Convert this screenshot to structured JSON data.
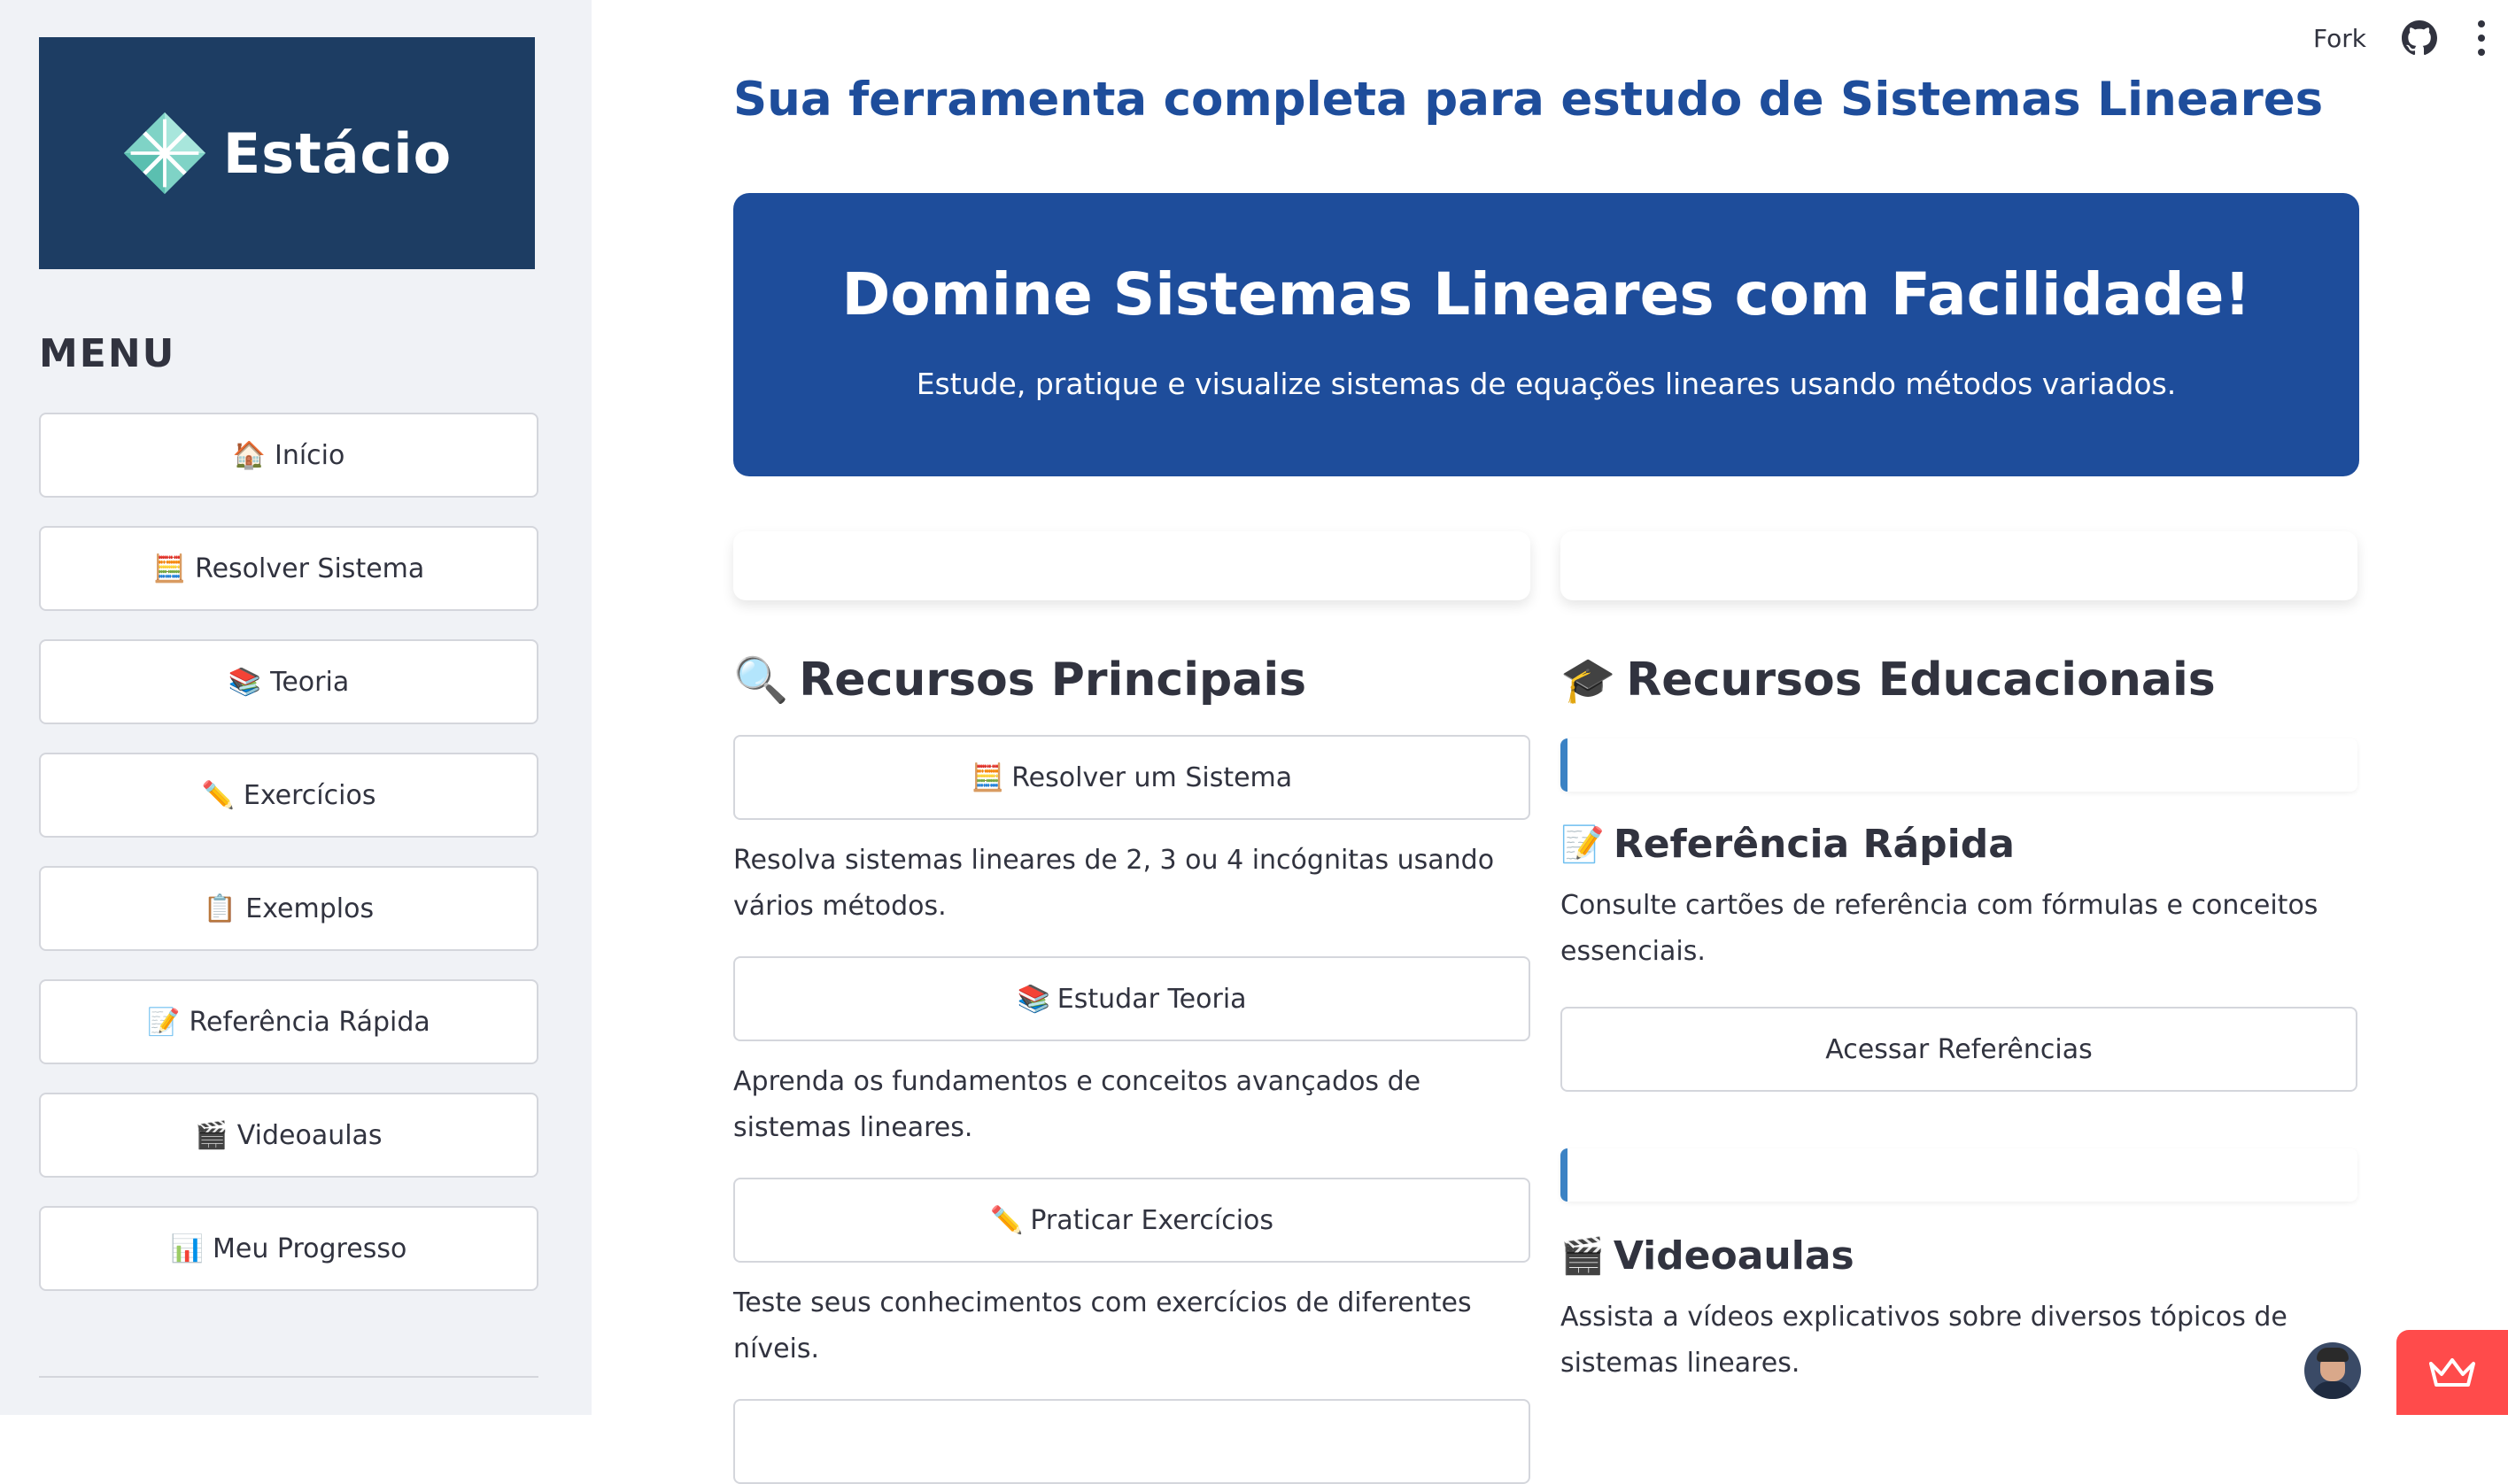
{
  "header": {
    "fork_label": "Fork",
    "github_icon": "github-icon",
    "menu_icon": "kebab-menu-icon"
  },
  "sidebar": {
    "logo_text": "Estácio",
    "menu_title": "MENU",
    "items": [
      {
        "icon": "🏠",
        "label": "Início"
      },
      {
        "icon": "🧮",
        "label": "Resolver Sistema"
      },
      {
        "icon": "📚",
        "label": "Teoria"
      },
      {
        "icon": "✏️",
        "label": "Exercícios"
      },
      {
        "icon": "📋",
        "label": "Exemplos"
      },
      {
        "icon": "📝",
        "label": "Referência Rápida"
      },
      {
        "icon": "🎬",
        "label": "Videoaulas"
      },
      {
        "icon": "📊",
        "label": "Meu Progresso"
      }
    ]
  },
  "main": {
    "title": "Sua ferramenta completa para estudo de Sistemas Lineares",
    "hero": {
      "title": "Domine Sistemas Lineares com Facilidade!",
      "subtitle": "Estude, pratique e visualize sistemas de equações lineares usando métodos variados."
    },
    "left": {
      "heading_icon": "🔍",
      "heading": "Recursos Principais",
      "items": [
        {
          "icon": "🧮",
          "button": "Resolver um Sistema",
          "desc": "Resolva sistemas lineares de 2, 3 ou 4 incógnitas usando vários métodos."
        },
        {
          "icon": "📚",
          "button": "Estudar Teoria",
          "desc": "Aprenda os fundamentos e conceitos avançados de sistemas lineares."
        },
        {
          "icon": "✏️",
          "button": "Praticar Exercícios",
          "desc": "Teste seus conhecimentos com exercícios de diferentes níveis."
        }
      ]
    },
    "right": {
      "heading_icon": "🎓",
      "heading": "Recursos Educacionais",
      "ref": {
        "icon": "📝",
        "title": "Referência Rápida",
        "desc": "Consulte cartões de referência com fórmulas e conceitos essenciais.",
        "button": "Acessar Referências"
      },
      "video": {
        "icon": "🎬",
        "title": "Videoaulas",
        "desc": "Assista a vídeos explicativos sobre diversos tópicos de sistemas lineares."
      }
    }
  },
  "colors": {
    "primary": "#1e4d9b",
    "sidebar_bg": "#f0f2f6",
    "logo_bg": "#1d3d63",
    "accent_bar": "#3b82c4",
    "badge": "#ff4b4b"
  }
}
